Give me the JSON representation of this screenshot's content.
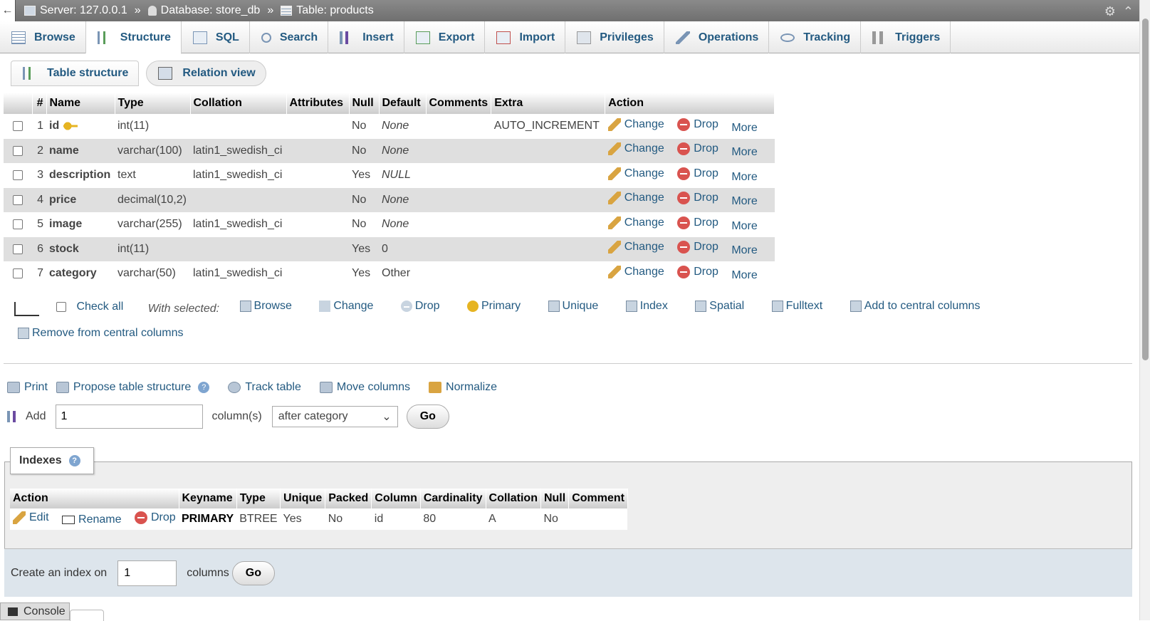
{
  "breadcrumb": {
    "server": "Server: 127.0.0.1",
    "database": "Database: store_db",
    "table": "Table: products",
    "separator": "»"
  },
  "tabs": [
    {
      "label": "Browse",
      "icon": "browse-icon"
    },
    {
      "label": "Structure",
      "icon": "structure-icon",
      "active": true
    },
    {
      "label": "SQL",
      "icon": "sql-icon"
    },
    {
      "label": "Search",
      "icon": "search-icon"
    },
    {
      "label": "Insert",
      "icon": "insert-icon"
    },
    {
      "label": "Export",
      "icon": "export-icon"
    },
    {
      "label": "Import",
      "icon": "import-icon"
    },
    {
      "label": "Privileges",
      "icon": "privileges-icon"
    },
    {
      "label": "Operations",
      "icon": "operations-icon"
    },
    {
      "label": "Tracking",
      "icon": "tracking-icon"
    },
    {
      "label": "Triggers",
      "icon": "triggers-icon"
    }
  ],
  "subtabs": {
    "table_structure": "Table structure",
    "relation_view": "Relation view"
  },
  "structure": {
    "headers": [
      "#",
      "Name",
      "Type",
      "Collation",
      "Attributes",
      "Null",
      "Default",
      "Comments",
      "Extra",
      "Action"
    ],
    "rows": [
      {
        "num": "1",
        "name": "id",
        "type": "int(11)",
        "collation": "",
        "attributes": "",
        "null": "No",
        "default": "None",
        "comments": "",
        "extra": "AUTO_INCREMENT",
        "primary": true
      },
      {
        "num": "2",
        "name": "name",
        "type": "varchar(100)",
        "collation": "latin1_swedish_ci",
        "attributes": "",
        "null": "No",
        "default": "None",
        "comments": "",
        "extra": ""
      },
      {
        "num": "3",
        "name": "description",
        "type": "text",
        "collation": "latin1_swedish_ci",
        "attributes": "",
        "null": "Yes",
        "default": "NULL",
        "comments": "",
        "extra": ""
      },
      {
        "num": "4",
        "name": "price",
        "type": "decimal(10,2)",
        "collation": "",
        "attributes": "",
        "null": "No",
        "default": "None",
        "comments": "",
        "extra": ""
      },
      {
        "num": "5",
        "name": "image",
        "type": "varchar(255)",
        "collation": "latin1_swedish_ci",
        "attributes": "",
        "null": "No",
        "default": "None",
        "comments": "",
        "extra": ""
      },
      {
        "num": "6",
        "name": "stock",
        "type": "int(11)",
        "collation": "",
        "attributes": "",
        "null": "Yes",
        "default": "0",
        "comments": "",
        "extra": ""
      },
      {
        "num": "7",
        "name": "category",
        "type": "varchar(50)",
        "collation": "latin1_swedish_ci",
        "attributes": "",
        "null": "Yes",
        "default": "Other",
        "comments": "",
        "extra": ""
      }
    ],
    "actions": {
      "change": "Change",
      "drop": "Drop",
      "more": "More"
    }
  },
  "with_selected": {
    "check_all": "Check all",
    "label": "With selected:",
    "items": [
      "Browse",
      "Change",
      "Drop",
      "Primary",
      "Unique",
      "Index",
      "Spatial",
      "Fulltext",
      "Add to central columns",
      "Remove from central columns"
    ]
  },
  "tools": {
    "print": "Print",
    "propose": "Propose table structure",
    "track": "Track table",
    "move": "Move columns",
    "normalize": "Normalize"
  },
  "add_columns": {
    "label": "Add",
    "value": "1",
    "unit": "column(s)",
    "position": "after category",
    "go": "Go"
  },
  "indexes": {
    "title": "Indexes",
    "headers": [
      "Action",
      "Keyname",
      "Type",
      "Unique",
      "Packed",
      "Column",
      "Cardinality",
      "Collation",
      "Null",
      "Comment"
    ],
    "row": {
      "edit": "Edit",
      "rename": "Rename",
      "drop": "Drop",
      "keyname": "PRIMARY",
      "type": "BTREE",
      "unique": "Yes",
      "packed": "No",
      "column": "id",
      "cardinality": "80",
      "collation": "A",
      "null": "No",
      "comment": ""
    },
    "create_label": "Create an index on",
    "create_value": "1",
    "create_unit": "columns",
    "go": "Go"
  },
  "console": {
    "label": "Console"
  }
}
